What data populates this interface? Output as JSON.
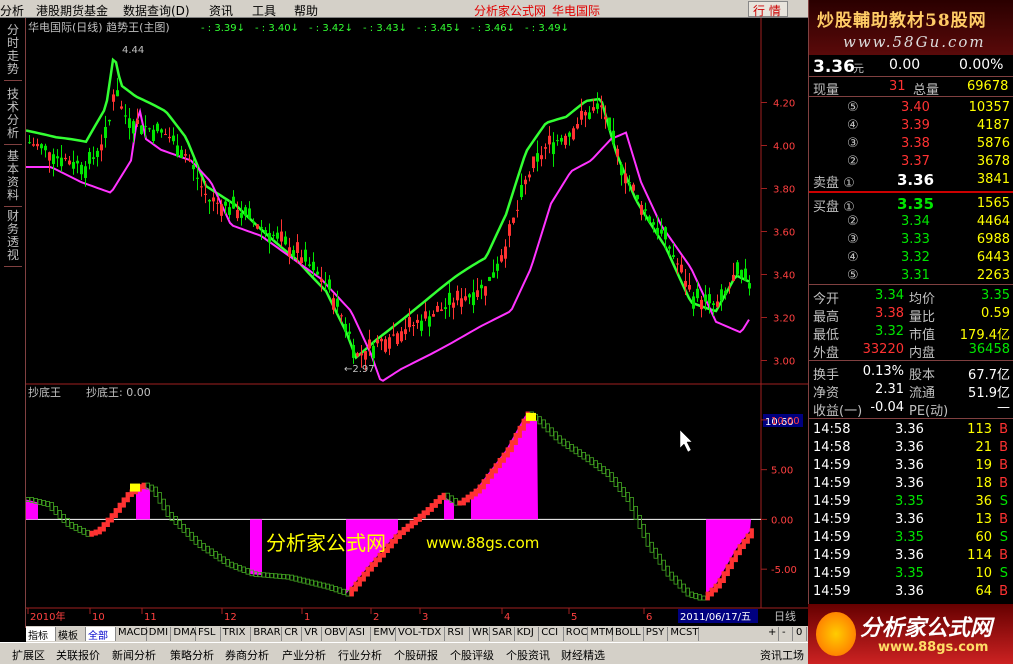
{
  "menu": {
    "items": [
      "分析",
      "港股期货基金",
      "数据查询(D)",
      "资讯",
      "工具",
      "帮助"
    ],
    "title": "分析家公式网",
    "title2": "华电国际",
    "hq_button": "行 情"
  },
  "left_tabs": [
    "分时走势",
    "技术分析",
    "基本资料",
    "财务透视"
  ],
  "main_chart": {
    "header_name": "华电国际(日线) 趋势王(主图)",
    "header_values": [
      "- : 3.39",
      "- : 3.40",
      "- : 3.42",
      "- : 3.43",
      "- : 3.45",
      "- : 3.46",
      "- : 3.49"
    ],
    "high_label": "4.44",
    "low_label": "←2.97",
    "y_ticks": [
      "4.20",
      "4.00",
      "3.80",
      "3.60",
      "3.40",
      "3.20",
      "3.00"
    ],
    "y_values": [
      4.2,
      4.0,
      3.8,
      3.6,
      3.4,
      3.2,
      3.0
    ]
  },
  "sub_chart": {
    "name": "抄底王",
    "value_label": "抄底王: 0.00",
    "current_value": "10.60",
    "y_ticks": [
      "10.00",
      "5.00",
      "0.00",
      "-5.00"
    ],
    "watermark_cn": "分析家公式网",
    "watermark_url": "www.88gs.com"
  },
  "x_axis": {
    "labels": [
      "2010年",
      "10",
      "11",
      "12",
      "1",
      "2",
      "3",
      "4",
      "5",
      "6"
    ],
    "current_date": "2011/06/17/五",
    "period": "日线"
  },
  "indicator_tabs": [
    "指标",
    "模板",
    "全部",
    "MACD",
    "DMI",
    "DMA",
    "FSL",
    "TRIX",
    "BRAR",
    "CR",
    "VR",
    "OBV",
    "ASI",
    "EMV",
    "VOL-TDX",
    "RSI",
    "WR",
    "SAR",
    "KDJ",
    "CCI",
    "ROC",
    "MTM",
    "BOLL",
    "PSY",
    "MCST"
  ],
  "bottom_tabs": [
    "扩展区",
    "关联报价",
    "新闻分析",
    "策略分析",
    "券商分析",
    "产业分析",
    "行业分析",
    "个股研报",
    "个股评级",
    "个股资讯",
    "财经精选",
    "资讯工场"
  ],
  "right_panel": {
    "banner_title": "炒股輔助教材58股网",
    "banner_url": "www.58Gu.com",
    "price": "3.36",
    "price_unit": "元",
    "change": "0.00",
    "change_pct": "0.00%",
    "current_vol_label": "现量",
    "current_vol": "31",
    "total_vol_label": "总量",
    "total_vol": "69678",
    "asks": [
      {
        "level": "⑤",
        "price": "3.40",
        "vol": "10357"
      },
      {
        "level": "④",
        "price": "3.39",
        "vol": "4187"
      },
      {
        "level": "③",
        "price": "3.38",
        "vol": "5876"
      },
      {
        "level": "②",
        "price": "3.37",
        "vol": "3678"
      },
      {
        "level": "卖盘 ①",
        "price": "3.36",
        "vol": "3841"
      }
    ],
    "bids": [
      {
        "level": "买盘 ①",
        "price": "3.35",
        "vol": "1565"
      },
      {
        "level": "②",
        "price": "3.34",
        "vol": "4464"
      },
      {
        "level": "③",
        "price": "3.33",
        "vol": "6988"
      },
      {
        "level": "④",
        "price": "3.32",
        "vol": "6443"
      },
      {
        "level": "⑤",
        "price": "3.31",
        "vol": "2263"
      }
    ],
    "stats": [
      {
        "l1": "今开",
        "v1": "3.34",
        "l2": "均价",
        "v2": "3.35"
      },
      {
        "l1": "最高",
        "v1": "3.38",
        "l2": "量比",
        "v2": "0.59"
      },
      {
        "l1": "最低",
        "v1": "3.32",
        "l2": "市值",
        "v2": "179.4亿"
      },
      {
        "l1": "外盘",
        "v1": "33220",
        "l2": "内盘",
        "v2": "36458"
      }
    ],
    "stats2": [
      {
        "l1": "换手",
        "v1": "0.13%",
        "l2": "股本",
        "v2": "67.7亿"
      },
      {
        "l1": "净资",
        "v1": "2.31",
        "l2": "流通",
        "v2": "51.9亿"
      },
      {
        "l1": "收益(一)",
        "v1": "-0.04",
        "l2": "PE(动)",
        "v2": "—"
      }
    ],
    "ticks": [
      {
        "time": "14:58",
        "price": "3.36",
        "vol": "113",
        "side": "B"
      },
      {
        "time": "14:58",
        "price": "3.36",
        "vol": "21",
        "side": "B"
      },
      {
        "time": "14:59",
        "price": "3.36",
        "vol": "19",
        "side": "B"
      },
      {
        "time": "14:59",
        "price": "3.36",
        "vol": "18",
        "side": "B"
      },
      {
        "time": "14:59",
        "price": "3.35",
        "vol": "36",
        "side": "S"
      },
      {
        "time": "14:59",
        "price": "3.36",
        "vol": "13",
        "side": "B"
      },
      {
        "time": "14:59",
        "price": "3.35",
        "vol": "60",
        "side": "S"
      },
      {
        "time": "14:59",
        "price": "3.36",
        "vol": "114",
        "side": "B"
      },
      {
        "time": "14:59",
        "price": "3.35",
        "vol": "10",
        "side": "S"
      },
      {
        "time": "14:59",
        "price": "3.36",
        "vol": "64",
        "side": "B"
      }
    ]
  },
  "logo": {
    "name": "分析家公式网",
    "url": "www.88gs.com"
  },
  "colors": {
    "up": "#ff3232",
    "down": "#00e600",
    "ma_green": "#33ff33",
    "ma_magenta": "#ff33ff",
    "fill_magenta": "#ff00ff"
  }
}
